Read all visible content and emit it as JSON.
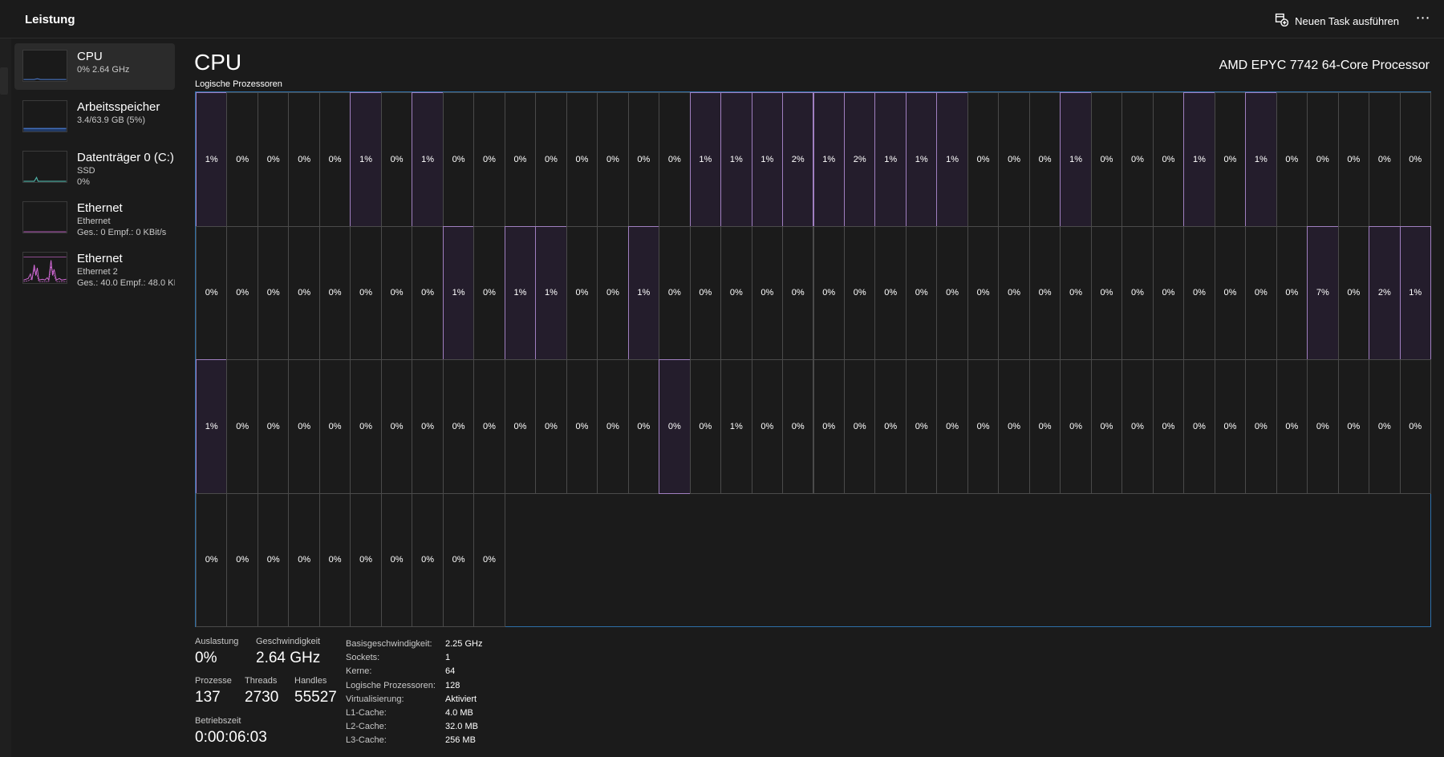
{
  "header": {
    "title": "Leistung",
    "run_task": "Neuen Task ausführen",
    "more": "⋯"
  },
  "sidebar": {
    "items": [
      {
        "title": "CPU",
        "line1": "0% 2.64 GHz",
        "line2": "",
        "selected": true,
        "icon": "cpu-graph"
      },
      {
        "title": "Arbeitsspeicher",
        "line1": "3.4/63.9 GB (5%)",
        "line2": "",
        "icon": "memory-graph"
      },
      {
        "title": "Datenträger 0 (C:)",
        "line1": "SSD",
        "line2": "0%",
        "icon": "disk-graph"
      },
      {
        "title": "Ethernet",
        "line1": "Ethernet",
        "line2": "Ges.: 0 Empf.: 0 KBit/s",
        "icon": "network-graph"
      },
      {
        "title": "Ethernet",
        "line1": "Ethernet 2",
        "line2": "Ges.: 40.0 Empf.: 48.0 KI",
        "icon": "network-graph"
      }
    ]
  },
  "main": {
    "title": "CPU",
    "processor": "AMD EPYC 7742 64-Core Processor",
    "logical_label": "Logische Prozessoren"
  },
  "cores": [
    "1%",
    "0%",
    "0%",
    "0%",
    "0%",
    "1%",
    "0%",
    "1%",
    "0%",
    "0%",
    "0%",
    "0%",
    "0%",
    "0%",
    "0%",
    "0%",
    "1%",
    "1%",
    "1%",
    "2%",
    "1%",
    "2%",
    "1%",
    "1%",
    "1%",
    "0%",
    "0%",
    "0%",
    "1%",
    "0%",
    "0%",
    "0%",
    "1%",
    "0%",
    "1%",
    "0%",
    "0%",
    "0%",
    "0%",
    "0%",
    "0%",
    "0%",
    "0%",
    "0%",
    "0%",
    "0%",
    "0%",
    "0%",
    "1%",
    "0%",
    "1%",
    "1%",
    "0%",
    "0%",
    "1%",
    "0%",
    "0%",
    "0%",
    "0%",
    "0%",
    "0%",
    "0%",
    "0%",
    "0%",
    "0%",
    "0%",
    "0%",
    "0%",
    "0%",
    "0%",
    "0%",
    "0%",
    "0%",
    "0%",
    "0%",
    "0%",
    "7%",
    "0%",
    "2%",
    "1%",
    "1%",
    "0%",
    "0%",
    "0%",
    "0%",
    "0%",
    "0%",
    "0%",
    "0%",
    "0%",
    "0%",
    "0%",
    "0%",
    "0%",
    "0%",
    "0%",
    "0%",
    "1%",
    "0%",
    "0%",
    "0%",
    "0%",
    "0%",
    "0%",
    "0%",
    "0%",
    "0%",
    "0%",
    "0%",
    "0%",
    "0%",
    "0%",
    "0%",
    "0%",
    "0%",
    "0%",
    "0%",
    "0%",
    "0%",
    "0%",
    "0%",
    "0%",
    "0%",
    "0%",
    "0%",
    "0%",
    "0%",
    "0%",
    "0%",
    "0%"
  ],
  "busy_cores": [
    0,
    5,
    7,
    16,
    17,
    18,
    19,
    20,
    21,
    22,
    23,
    24,
    28,
    32,
    34,
    48,
    50,
    51,
    54,
    76,
    78,
    79,
    80,
    95
  ],
  "stats": {
    "auslastung_label": "Auslastung",
    "auslastung": "0%",
    "geschwindigkeit_label": "Geschwindigkeit",
    "geschwindigkeit": "2.64 GHz",
    "prozesse_label": "Prozesse",
    "prozesse": "137",
    "threads_label": "Threads",
    "threads": "2730",
    "handles_label": "Handles",
    "handles": "55527",
    "betriebszeit_label": "Betriebszeit",
    "betriebszeit": "0:00:06:03"
  },
  "specs": [
    {
      "k": "Basisgeschwindigkeit:",
      "v": "2.25 GHz"
    },
    {
      "k": "Sockets:",
      "v": "1"
    },
    {
      "k": "Kerne:",
      "v": "64"
    },
    {
      "k": "Logische Prozessoren:",
      "v": "128"
    },
    {
      "k": "Virtualisierung:",
      "v": "Aktiviert"
    },
    {
      "k": "L1-Cache:",
      "v": "4.0 MB"
    },
    {
      "k": "L2-Cache:",
      "v": "32.0 MB"
    },
    {
      "k": "L3-Cache:",
      "v": "256 MB"
    }
  ],
  "colors": {
    "background": "#1b1b1b",
    "grid_border": "#2e6fa8",
    "busy_border": "#a07fc0",
    "busy_fill": "#241d2c",
    "memory_line": "#4d7fd8",
    "disk_line": "#4fb3a8",
    "network_line": "#d46ad8"
  }
}
